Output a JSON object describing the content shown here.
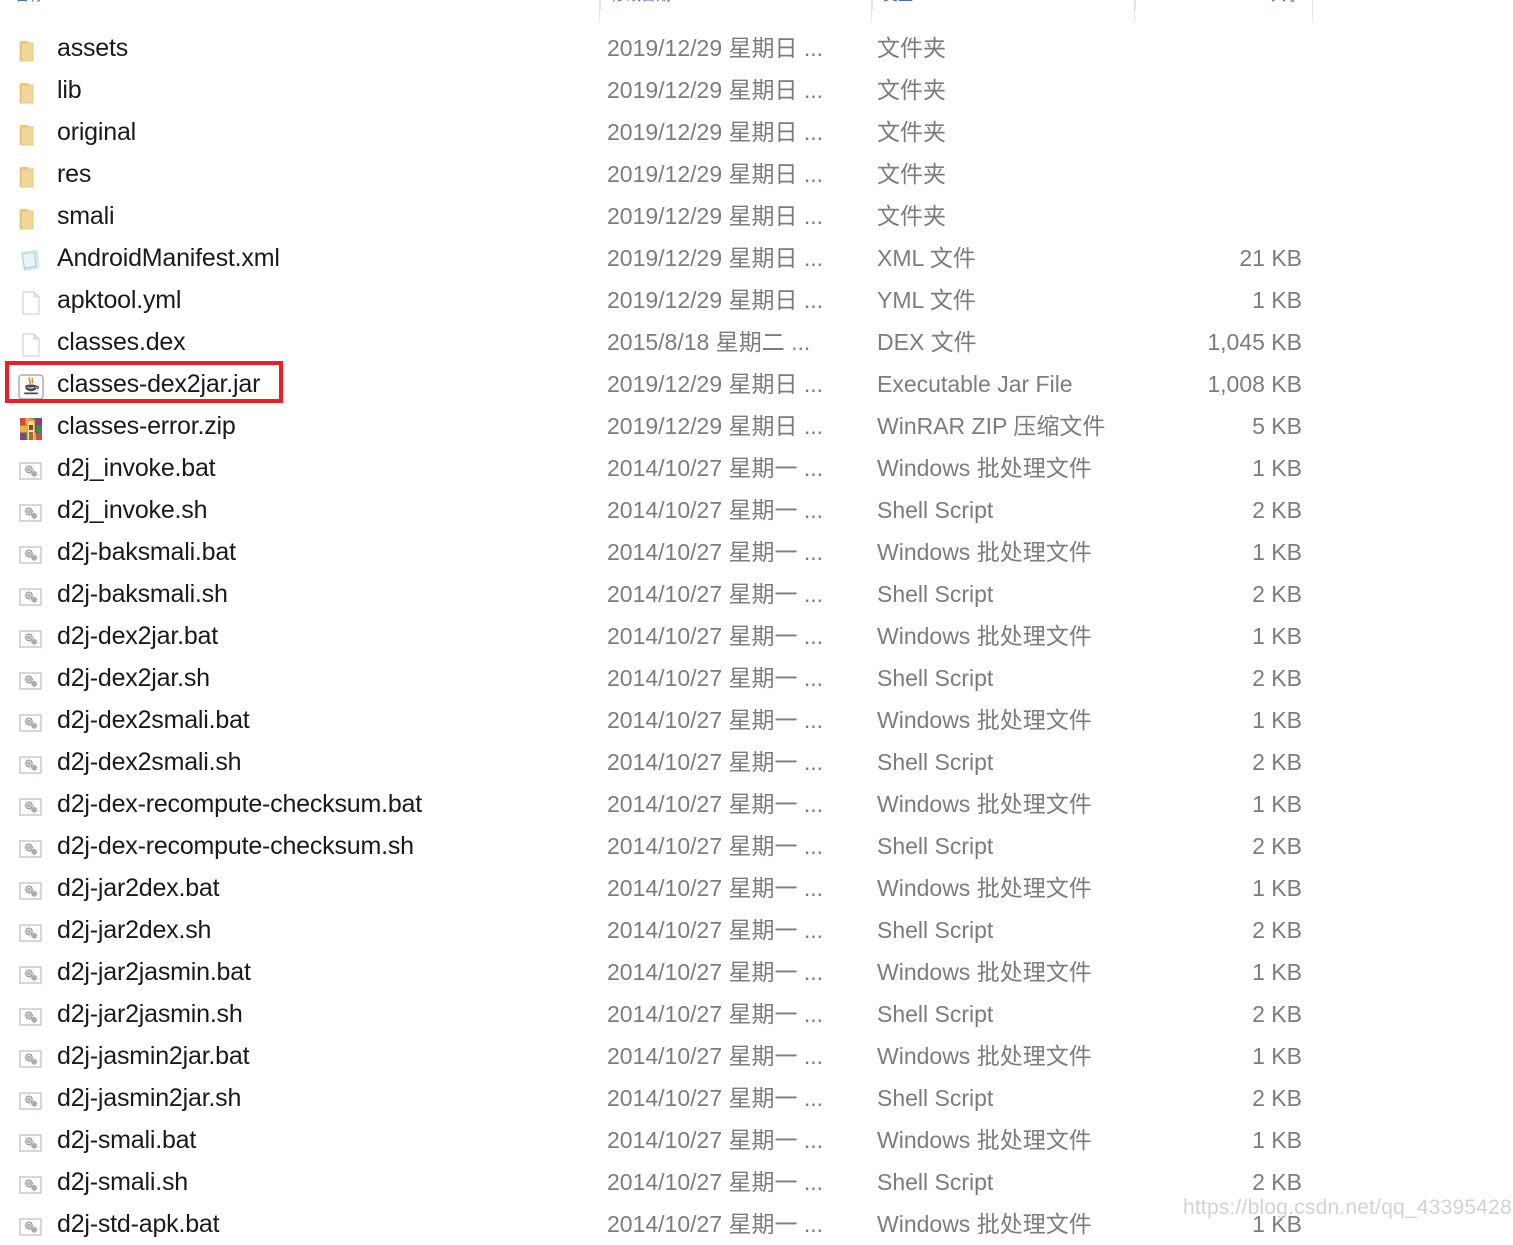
{
  "columns": {
    "name": "名称",
    "date": "修改日期",
    "type": "类型",
    "size": "大小"
  },
  "watermark": "https://blog.csdn.net/qq_43395428",
  "colors": {
    "highlight": "#ee1c25",
    "header_text": "#4a6fa5",
    "name_text": "#1a1a1a",
    "meta_text": "#7c7c7c",
    "folder": "#f7d48a",
    "watermark": "#cfd3d8"
  },
  "rows": [
    {
      "icon": "folder-icon",
      "name": "assets",
      "date": "2019/12/29 星期日 ...",
      "type": "文件夹",
      "size": ""
    },
    {
      "icon": "folder-icon",
      "name": "lib",
      "date": "2019/12/29 星期日 ...",
      "type": "文件夹",
      "size": ""
    },
    {
      "icon": "folder-icon",
      "name": "original",
      "date": "2019/12/29 星期日 ...",
      "type": "文件夹",
      "size": ""
    },
    {
      "icon": "folder-icon",
      "name": "res",
      "date": "2019/12/29 星期日 ...",
      "type": "文件夹",
      "size": ""
    },
    {
      "icon": "folder-icon",
      "name": "smali",
      "date": "2019/12/29 星期日 ...",
      "type": "文件夹",
      "size": ""
    },
    {
      "icon": "xml-file-icon",
      "name": "AndroidManifest.xml",
      "date": "2019/12/29 星期日 ...",
      "type": "XML 文件",
      "size": "21 KB"
    },
    {
      "icon": "blank-file-icon",
      "name": "apktool.yml",
      "date": "2019/12/29 星期日 ...",
      "type": "YML 文件",
      "size": "1 KB"
    },
    {
      "icon": "blank-file-icon",
      "name": "classes.dex",
      "date": "2015/8/18 星期二 ...",
      "type": "DEX 文件",
      "size": "1,045 KB"
    },
    {
      "icon": "java-jar-icon",
      "name": "classes-dex2jar.jar",
      "date": "2019/12/29 星期日 ...",
      "type": "Executable Jar File",
      "size": "1,008 KB",
      "highlighted": true
    },
    {
      "icon": "winrar-zip-icon",
      "name": "classes-error.zip",
      "date": "2019/12/29 星期日 ...",
      "type": "WinRAR ZIP 压缩文件",
      "size": "5 KB"
    },
    {
      "icon": "script-gear-icon",
      "name": "d2j_invoke.bat",
      "date": "2014/10/27 星期一 ...",
      "type": "Windows 批处理文件",
      "size": "1 KB"
    },
    {
      "icon": "script-gear-icon",
      "name": "d2j_invoke.sh",
      "date": "2014/10/27 星期一 ...",
      "type": "Shell Script",
      "size": "2 KB"
    },
    {
      "icon": "script-gear-icon",
      "name": "d2j-baksmali.bat",
      "date": "2014/10/27 星期一 ...",
      "type": "Windows 批处理文件",
      "size": "1 KB"
    },
    {
      "icon": "script-gear-icon",
      "name": "d2j-baksmali.sh",
      "date": "2014/10/27 星期一 ...",
      "type": "Shell Script",
      "size": "2 KB"
    },
    {
      "icon": "script-gear-icon",
      "name": "d2j-dex2jar.bat",
      "date": "2014/10/27 星期一 ...",
      "type": "Windows 批处理文件",
      "size": "1 KB"
    },
    {
      "icon": "script-gear-icon",
      "name": "d2j-dex2jar.sh",
      "date": "2014/10/27 星期一 ...",
      "type": "Shell Script",
      "size": "2 KB"
    },
    {
      "icon": "script-gear-icon",
      "name": "d2j-dex2smali.bat",
      "date": "2014/10/27 星期一 ...",
      "type": "Windows 批处理文件",
      "size": "1 KB"
    },
    {
      "icon": "script-gear-icon",
      "name": "d2j-dex2smali.sh",
      "date": "2014/10/27 星期一 ...",
      "type": "Shell Script",
      "size": "2 KB"
    },
    {
      "icon": "script-gear-icon",
      "name": "d2j-dex-recompute-checksum.bat",
      "date": "2014/10/27 星期一 ...",
      "type": "Windows 批处理文件",
      "size": "1 KB"
    },
    {
      "icon": "script-gear-icon",
      "name": "d2j-dex-recompute-checksum.sh",
      "date": "2014/10/27 星期一 ...",
      "type": "Shell Script",
      "size": "2 KB"
    },
    {
      "icon": "script-gear-icon",
      "name": "d2j-jar2dex.bat",
      "date": "2014/10/27 星期一 ...",
      "type": "Windows 批处理文件",
      "size": "1 KB"
    },
    {
      "icon": "script-gear-icon",
      "name": "d2j-jar2dex.sh",
      "date": "2014/10/27 星期一 ...",
      "type": "Shell Script",
      "size": "2 KB"
    },
    {
      "icon": "script-gear-icon",
      "name": "d2j-jar2jasmin.bat",
      "date": "2014/10/27 星期一 ...",
      "type": "Windows 批处理文件",
      "size": "1 KB"
    },
    {
      "icon": "script-gear-icon",
      "name": "d2j-jar2jasmin.sh",
      "date": "2014/10/27 星期一 ...",
      "type": "Shell Script",
      "size": "2 KB"
    },
    {
      "icon": "script-gear-icon",
      "name": "d2j-jasmin2jar.bat",
      "date": "2014/10/27 星期一 ...",
      "type": "Windows 批处理文件",
      "size": "1 KB"
    },
    {
      "icon": "script-gear-icon",
      "name": "d2j-jasmin2jar.sh",
      "date": "2014/10/27 星期一 ...",
      "type": "Shell Script",
      "size": "2 KB"
    },
    {
      "icon": "script-gear-icon",
      "name": "d2j-smali.bat",
      "date": "2014/10/27 星期一 ...",
      "type": "Windows 批处理文件",
      "size": "1 KB"
    },
    {
      "icon": "script-gear-icon",
      "name": "d2j-smali.sh",
      "date": "2014/10/27 星期一 ...",
      "type": "Shell Script",
      "size": "2 KB"
    },
    {
      "icon": "script-gear-icon",
      "name": "d2j-std-apk.bat",
      "date": "2014/10/27 星期一 ...",
      "type": "Windows 批处理文件",
      "size": "1 KB"
    }
  ]
}
